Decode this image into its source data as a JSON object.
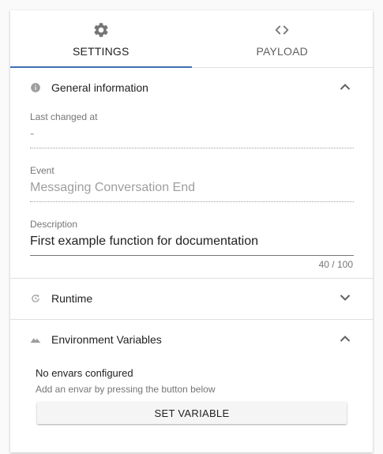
{
  "tabs": [
    {
      "label": "SETTINGS",
      "icon": "gear-icon",
      "active": true
    },
    {
      "label": "PAYLOAD",
      "icon": "code-icon",
      "active": false
    }
  ],
  "general": {
    "title": "General information",
    "icon": "info-icon",
    "expanded": true,
    "last_changed_label": "Last changed at",
    "last_changed_value": "-",
    "event_label": "Event",
    "event_value": "Messaging Conversation End",
    "description_label": "Description",
    "description_value": "First example function for documentation",
    "description_counter": "40 / 100"
  },
  "runtime": {
    "title": "Runtime",
    "icon": "history-icon",
    "expanded": false
  },
  "env": {
    "title": "Environment Variables",
    "icon": "landscape-icon",
    "expanded": true,
    "empty_title": "No envars configured",
    "empty_hint": "Add an envar by pressing the button below",
    "button_label": "SET VARIABLE"
  },
  "colors": {
    "accent": "#3f6db5",
    "icon_grey": "#757575"
  }
}
